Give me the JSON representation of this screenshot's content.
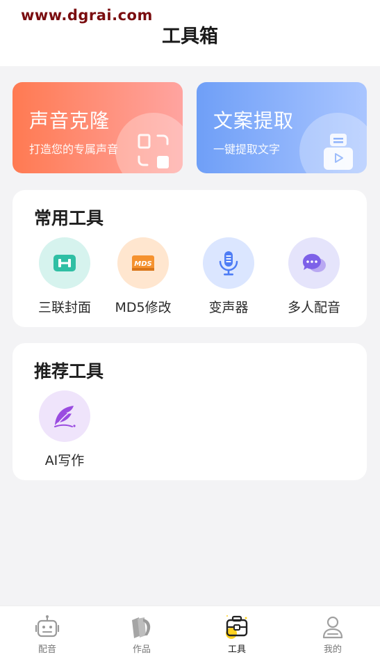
{
  "watermark": "www.dgrai.com",
  "header": {
    "title": "工具箱"
  },
  "feature_cards": {
    "voice_clone": {
      "title": "声音克隆",
      "subtitle": "打造您的专属声音"
    },
    "text_extract": {
      "title": "文案提取",
      "subtitle": "一键提取文字"
    }
  },
  "common_tools": {
    "title": "常用工具",
    "items": [
      {
        "label": "三联封面",
        "icon": "cover-icon"
      },
      {
        "label": "MD5修改",
        "icon": "md5-icon"
      },
      {
        "label": "变声器",
        "icon": "microphone-icon"
      },
      {
        "label": "多人配音",
        "icon": "chat-bubbles-icon"
      }
    ]
  },
  "recommend_tools": {
    "title": "推荐工具",
    "items": [
      {
        "label": "AI写作",
        "icon": "quill-icon"
      }
    ]
  },
  "tabbar": {
    "items": [
      {
        "label": "配音",
        "icon": "robot-icon",
        "active": false
      },
      {
        "label": "作品",
        "icon": "works-icon",
        "active": false
      },
      {
        "label": "工具",
        "icon": "toolbox-icon",
        "active": true
      },
      {
        "label": "我的",
        "icon": "person-icon",
        "active": false
      }
    ]
  },
  "colors": {
    "clone_card": [
      "#ff7a52",
      "#ffa4a0"
    ],
    "extract_card": [
      "#6f9ff7",
      "#a9c5ff"
    ],
    "active_tab_accent": "#ffd21f"
  }
}
